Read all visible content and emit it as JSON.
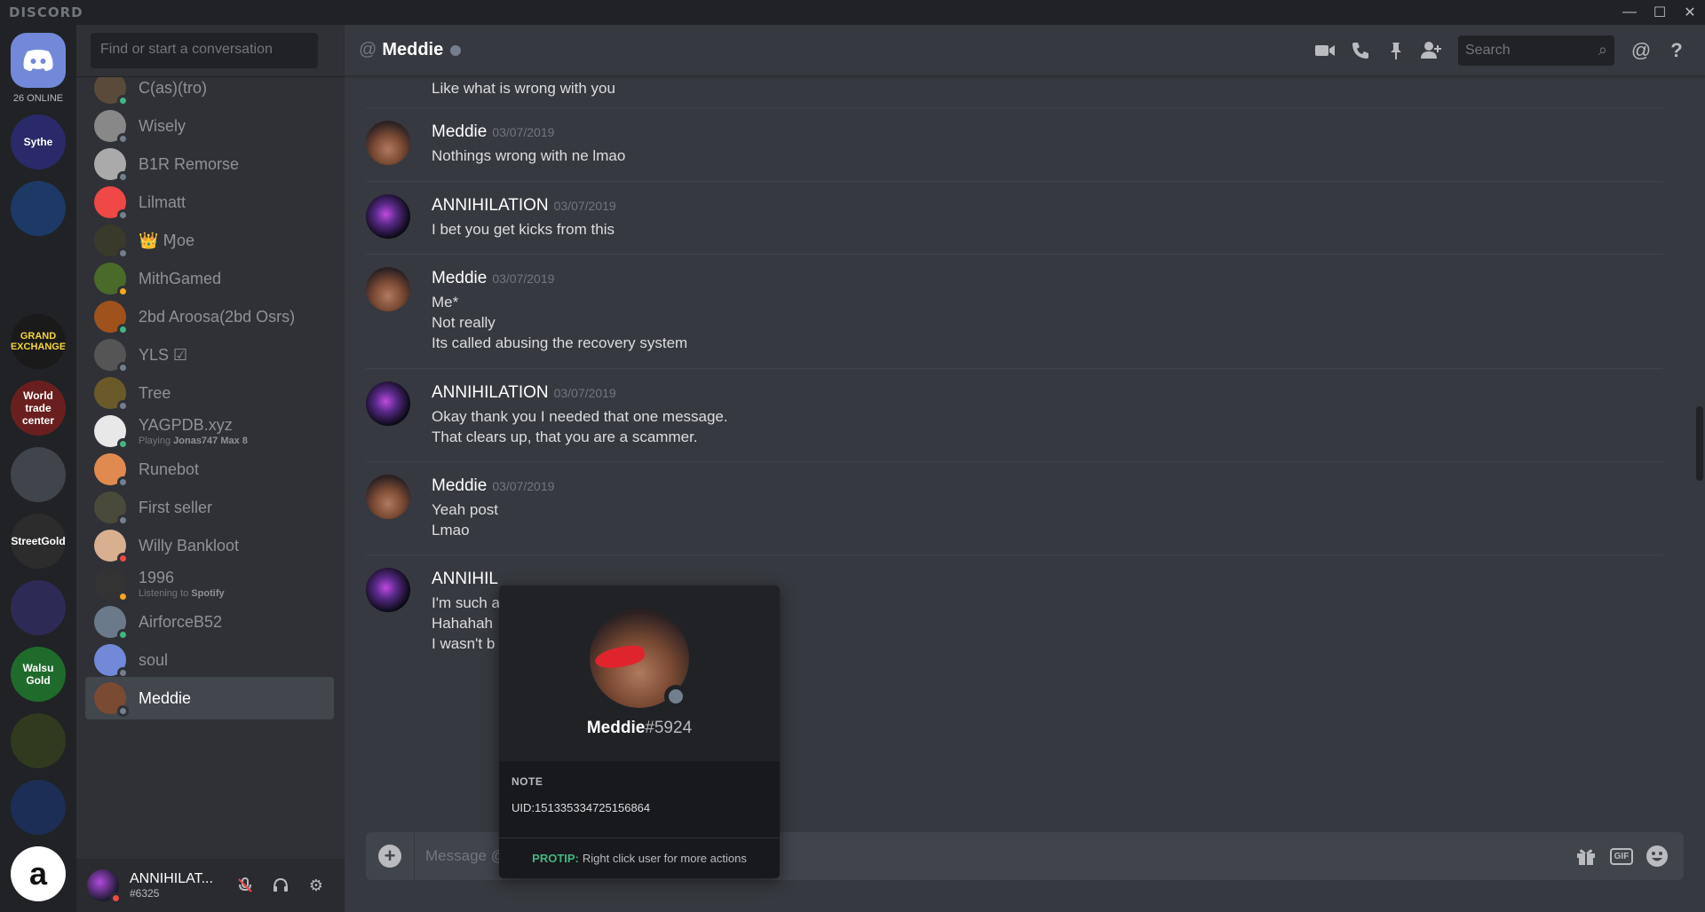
{
  "app": {
    "brand": "DISCORD"
  },
  "guilds": {
    "online_count": "26 ONLINE",
    "items": [
      {
        "name": "Sythe",
        "label": "Sythe",
        "color": "#2a2a6a"
      },
      {
        "name": "flask",
        "label": "",
        "color": "#1d3a66"
      },
      {
        "name": "red-heart",
        "label": "",
        "color": "#202225"
      },
      {
        "name": "Grand Exchange",
        "label": "GRAND EXCHANGE",
        "color": "#1a1a1a"
      },
      {
        "name": "World Trade Center",
        "label": "World trade center",
        "color": "#6a1f1f"
      },
      {
        "name": "controller",
        "label": "",
        "color": "#40444b"
      },
      {
        "name": "StreetGold",
        "label": "StreetGold",
        "color": "#2c2c2c"
      },
      {
        "name": "Swapper",
        "label": "",
        "color": "#2d2a55"
      },
      {
        "name": "WalsuGold",
        "label": "Walsu Gold",
        "color": "#1f6b2b"
      },
      {
        "name": "green-figure",
        "label": "",
        "color": "#2f3a1f"
      },
      {
        "name": "blue-shield",
        "label": "",
        "color": "#1c2e55"
      },
      {
        "name": "amazon",
        "label": "a",
        "color": "#ffffff"
      }
    ]
  },
  "dm": {
    "search_placeholder": "Find or start a conversation",
    "items": [
      {
        "name": "C(as)(tro)",
        "sub": "",
        "status": "#43b581",
        "av": "#5a4a3a"
      },
      {
        "name": "Wisely",
        "sub": "",
        "status": "#747f8d",
        "av": "#888888"
      },
      {
        "name": "B1R Remorse",
        "sub": "",
        "status": "#747f8d",
        "av": "#aaaaaa"
      },
      {
        "name": "Lilmatt",
        "sub": "",
        "status": "#747f8d",
        "av": "#f04747"
      },
      {
        "name": "👑 Ɱoe",
        "sub": "",
        "status": "#747f8d",
        "av": "#3a3a2a"
      },
      {
        "name": "MithGamed",
        "sub": "",
        "status": "#faa61a",
        "av": "#4a6a2a"
      },
      {
        "name": "2bd Aroosa(2bd Osrs)",
        "sub": "",
        "status": "#43b581",
        "av": "#a0521d"
      },
      {
        "name": "YLS ☑",
        "sub": "",
        "status": "#747f8d",
        "av": "#555555"
      },
      {
        "name": "Tree",
        "sub": "",
        "status": "#747f8d",
        "av": "#6a5a2a"
      },
      {
        "name": "YAGPDB.xyz",
        "sub_prefix": "Playing ",
        "sub_bold": "Jonas747 Max 8",
        "status": "#43b581",
        "av": "#e8e8e8"
      },
      {
        "name": "Runebot",
        "sub": "",
        "status": "#747f8d",
        "av": "#e08a50"
      },
      {
        "name": "First seller",
        "sub": "",
        "status": "#747f8d",
        "av": "#4a4a3a"
      },
      {
        "name": "Willy Bankloot",
        "sub": "",
        "status": "#f04747",
        "av": "#d8b090"
      },
      {
        "name": "1996",
        "sub_prefix": "Listening to ",
        "sub_bold": "Spotify",
        "status": "#faa61a",
        "av": "#333333"
      },
      {
        "name": "AirforceB52",
        "sub": "",
        "status": "#43b581",
        "av": "#6a7a8a"
      },
      {
        "name": "soul",
        "sub": "",
        "status": "#747f8d",
        "av": "#7289da"
      },
      {
        "name": "Meddie",
        "sub": "",
        "status": "#747f8d",
        "av": "#7a4a33"
      }
    ]
  },
  "user": {
    "name": "ANNIHILAT...",
    "tag": "#6325"
  },
  "chat": {
    "title": "Meddie",
    "search_placeholder": "Search",
    "partial_line": "Like what is wrong with you",
    "messages": [
      {
        "author": "Meddie",
        "time": "03/07/2019",
        "lines": [
          "Nothings wrong with ne lmao"
        ]
      },
      {
        "author": "ANNIHILATION",
        "time": "03/07/2019",
        "lines": [
          "I bet you get kicks from this"
        ]
      },
      {
        "author": "Meddie",
        "time": "03/07/2019",
        "lines": [
          "Me*",
          "Not really",
          "Its called abusing the recovery system"
        ]
      },
      {
        "author": "ANNIHILATION",
        "time": "03/07/2019",
        "lines": [
          "Okay thank you I needed that one message.",
          "That clears up, that you are a scammer."
        ]
      },
      {
        "author": "Meddie",
        "time": "03/07/2019",
        "lines": [
          "Yeah post",
          "Lmao"
        ]
      },
      {
        "author": "ANNIHIL",
        "time": "",
        "lines": [
          "I'm such a",
          "Hahahah",
          "I wasn't b"
        ]
      }
    ],
    "composer_placeholder": "Message @"
  },
  "popout": {
    "username": "Meddie",
    "discriminator": "#5924",
    "note_header": "NOTE",
    "note": "UID:151335334725156864",
    "protip_label": "PROTIP:",
    "protip_text": "Right click user for more actions"
  }
}
